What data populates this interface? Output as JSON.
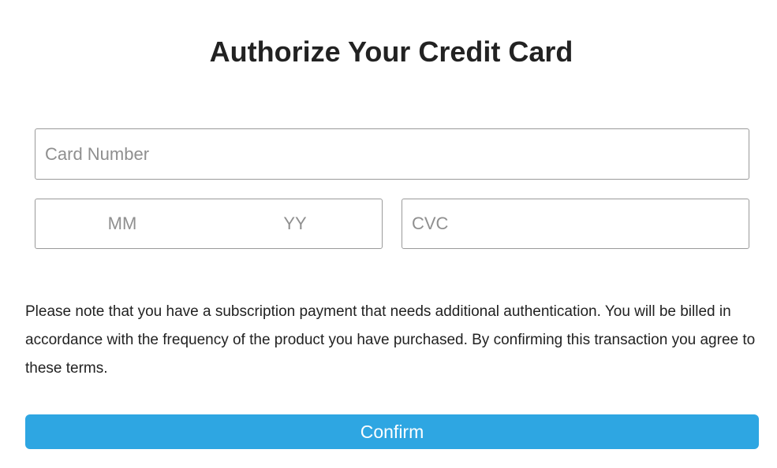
{
  "header": {
    "title": "Authorize Your Credit Card"
  },
  "form": {
    "card_number": {
      "placeholder": "Card Number",
      "value": ""
    },
    "expiry_month": {
      "placeholder": "MM",
      "value": ""
    },
    "expiry_year": {
      "placeholder": "YY",
      "value": ""
    },
    "cvc": {
      "placeholder": "CVC",
      "value": ""
    }
  },
  "notice": {
    "text": "Please note that you have a subscription payment that needs additional authentication. You will be billed in accordance with the frequency of the product you have purchased. By confirming this transaction you agree to these terms."
  },
  "actions": {
    "confirm_label": "Confirm"
  },
  "colors": {
    "accent": "#2ea6e2",
    "border": "#9a9a9a",
    "placeholder": "#8f8f8f",
    "text": "#222222"
  }
}
